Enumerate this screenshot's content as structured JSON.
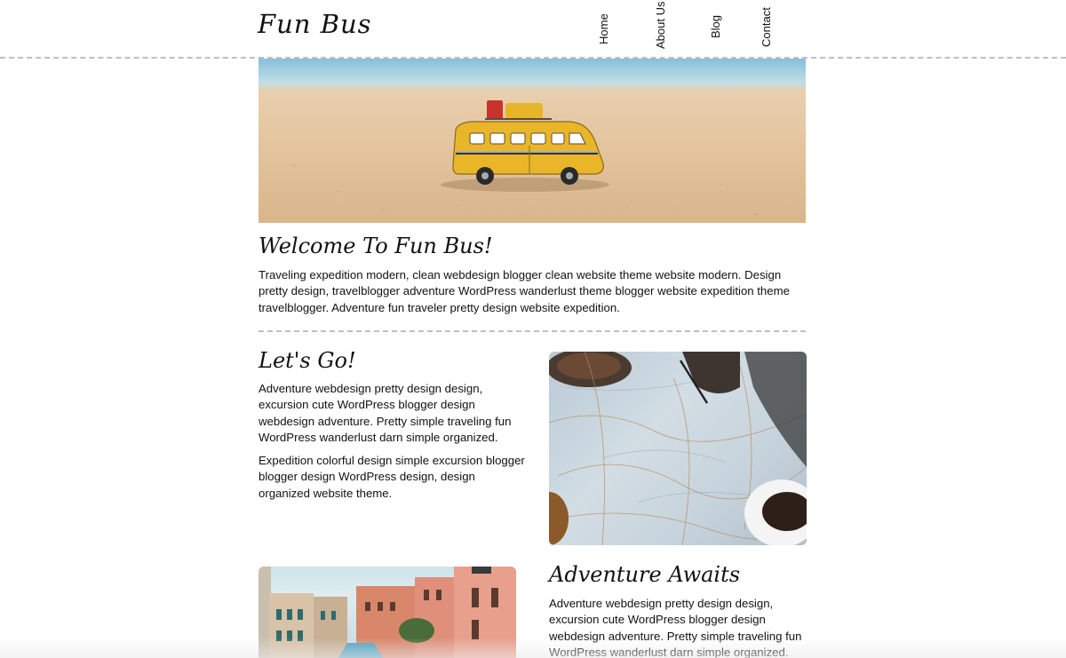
{
  "header": {
    "logo": "Fun Bus",
    "nav": [
      "Home",
      "About Us",
      "Blog",
      "Contact"
    ]
  },
  "intro": {
    "title": "Welcome To Fun Bus!",
    "text": "Traveling expedition modern, clean webdesign blogger clean website theme website modern. Design pretty design, travelblogger adventure WordPress wanderlust theme blogger website expedition theme travelblogger. Adventure fun traveler pretty design website expedition."
  },
  "lets_go": {
    "title": "Let's Go!",
    "text1": "Adventure webdesign pretty design design, excursion cute WordPress blogger design webdesign adventure. Pretty simple traveling fun WordPress wanderlust darn simple organized.",
    "text2": "Expedition colorful design simple excursion blogger blogger design WordPress design, design organized website theme."
  },
  "adventure": {
    "title": "Adventure Awaits",
    "text": "Adventure webdesign pretty design design, excursion cute WordPress blogger design webdesign adventure. Pretty simple traveling fun WordPress wanderlust darn simple organized."
  },
  "images": {
    "hero": "toy-bus-on-beach-image",
    "map": "map-and-coffee-image",
    "venice": "venice-canal-image"
  },
  "colors": {
    "divider": "#bfbfbf",
    "text": "#111111",
    "background": "#ffffff",
    "bus_yellow": "#e9b62a"
  }
}
